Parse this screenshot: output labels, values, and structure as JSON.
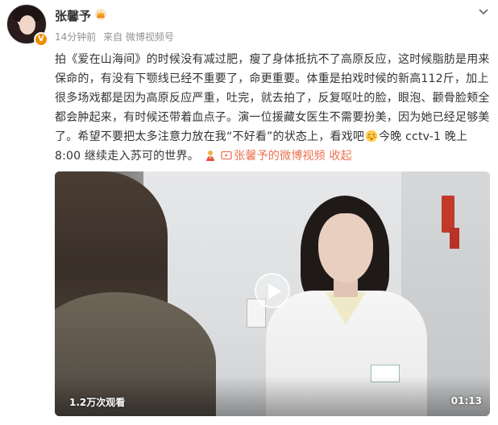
{
  "user": {
    "name": "张馨予",
    "time": "14分钟前",
    "source": "来自 微博视频号"
  },
  "post": {
    "text_part1": "拍《爱在山海间》的时候没有减过肥，瘦了身体抵抗不了高原反应，这时候脂肪是用来保命的，有没有下颚线已经不重要了，命更重要。体重是拍戏时候的新高112斤，加上很多场戏都是因为高原反应严重，吐完，就去拍了，反复呕吐的脸，眼泡、颧骨脸颊全都会肿起来，有时候还带着血点子。演一位援藏女医生不需要扮美，因为她已经足够美了。希望不要把太多注意力放在我“不好看”的状态上，看戏吧",
    "text_part2": "今晚 cctv-1 晚上 8:00 继续走入苏可的世界。",
    "video_link": "张馨予的微博视频",
    "collapse": "收起"
  },
  "video": {
    "views": "1.2万次观看",
    "duration": "01:13"
  },
  "colors": {
    "link": "#eb7350",
    "meta": "#939393",
    "badge": "#f08c00"
  },
  "icons": [
    "crown-icon",
    "chevron-down-icon",
    "blush-emoji-icon",
    "pray-emoji-icon",
    "video-link-icon",
    "play-icon",
    "verified-badge-icon"
  ]
}
